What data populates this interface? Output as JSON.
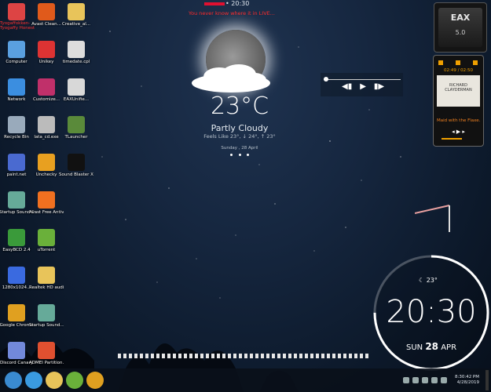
{
  "top": {
    "time": "20:30",
    "message": "You never know where it in LIVE...",
    "name_tag": "Tyogaffokken- Tyogaffy Honest"
  },
  "desktop_icons": [
    {
      "label": "",
      "icon": "user-folder-icon",
      "color": "#d44"
    },
    {
      "label": "Avast Clean...",
      "icon": "avast-cleanup-icon",
      "color": "#e05a1b"
    },
    {
      "label": "Creative_al...",
      "icon": "folder-icon",
      "color": "#e8c45a"
    },
    {
      "label": "Computer",
      "icon": "computer-icon",
      "color": "#5aa0e0"
    },
    {
      "label": "Unikey",
      "icon": "unikey-icon",
      "color": "#d33"
    },
    {
      "label": "timedate.cpl",
      "icon": "file-icon",
      "color": "#ddd"
    },
    {
      "label": "Network",
      "icon": "network-icon",
      "color": "#3b8ee0"
    },
    {
      "label": "Customize...",
      "icon": "customize-icon",
      "color": "#c0306a"
    },
    {
      "label": "EAXUnifie...",
      "icon": "eax-unified-icon",
      "color": "#d8d8d8"
    },
    {
      "label": "Recycle Bin",
      "icon": "recycle-bin-icon",
      "color": "#9ab"
    },
    {
      "label": "lata_cd.exe",
      "icon": "exe-icon",
      "color": "#bbb"
    },
    {
      "label": "TLauncher",
      "icon": "tlauncher-icon",
      "color": "#5a8a3a"
    },
    {
      "label": "paint.net",
      "icon": "paint-net-icon",
      "color": "#4a6ad0"
    },
    {
      "label": "Unchecky",
      "icon": "unchecky-icon",
      "color": "#e8a020"
    },
    {
      "label": "Sound Blaster X-...",
      "icon": "sound-blaster-icon",
      "color": "#111"
    },
    {
      "label": "Startup Sound Cha...",
      "icon": "startup-sound-icon",
      "color": "#6a9"
    },
    {
      "label": "Avast Free Antivirus",
      "icon": "avast-icon",
      "color": "#f07020"
    },
    {
      "label": "",
      "icon": "",
      "color": ""
    },
    {
      "label": "EasyBCD 2.4",
      "icon": "easybcd-icon",
      "color": "#3a9a3a"
    },
    {
      "label": "uTorrent",
      "icon": "utorrent-icon",
      "color": "#6ab03a"
    },
    {
      "label": "",
      "icon": "",
      "color": ""
    },
    {
      "label": "1280x1024...",
      "icon": "image-icon",
      "color": "#3a6ae0"
    },
    {
      "label": "Realtek HD audio MO...",
      "icon": "folder-icon",
      "color": "#e8c45a"
    },
    {
      "label": "",
      "icon": "",
      "color": ""
    },
    {
      "label": "Google Chrome",
      "icon": "chrome-icon",
      "color": "#e0a020"
    },
    {
      "label": "Startup Sound...",
      "icon": "startup-sound-icon",
      "color": "#6a9"
    },
    {
      "label": "",
      "icon": "",
      "color": ""
    },
    {
      "label": "Discord Canary",
      "icon": "discord-icon",
      "color": "#7289da"
    },
    {
      "label": "ADMEI Partition...",
      "icon": "partition-icon",
      "color": "#e05030"
    }
  ],
  "weather": {
    "temperature": "23°C",
    "condition": "Partly Cloudy",
    "feels_like": "Feels Like 23°, ↓ 24°, ↑ 23°",
    "date": "Sunday , 28 April"
  },
  "eax": {
    "title": "EAX",
    "version": "5.0"
  },
  "music": {
    "time": "02:49 / 02:50",
    "album_text": "RICHARD CLAYDERMAN",
    "title": "Maid with the Flaxe...",
    "controls": "◂  ▶  ▸"
  },
  "media_player": {
    "prev": "◀▮",
    "play": "▶",
    "next": "▮▶",
    "progress": 0.02
  },
  "big_clock": {
    "weather_temp": "23°",
    "time": "20:30",
    "day": "SUN",
    "date": "28",
    "month": "APR",
    "progress": 0.75
  },
  "taskbar": {
    "clock_time": "8:30:42 PM",
    "clock_date": "4/28/2019",
    "apps": [
      {
        "name": "start",
        "color": "#3a8ad0"
      },
      {
        "name": "internet-explorer",
        "color": "#3a9ae0"
      },
      {
        "name": "file-explorer",
        "color": "#e8c45a"
      },
      {
        "name": "utorrent",
        "color": "#6ab03a"
      },
      {
        "name": "chrome",
        "color": "#e0a020"
      }
    ]
  }
}
